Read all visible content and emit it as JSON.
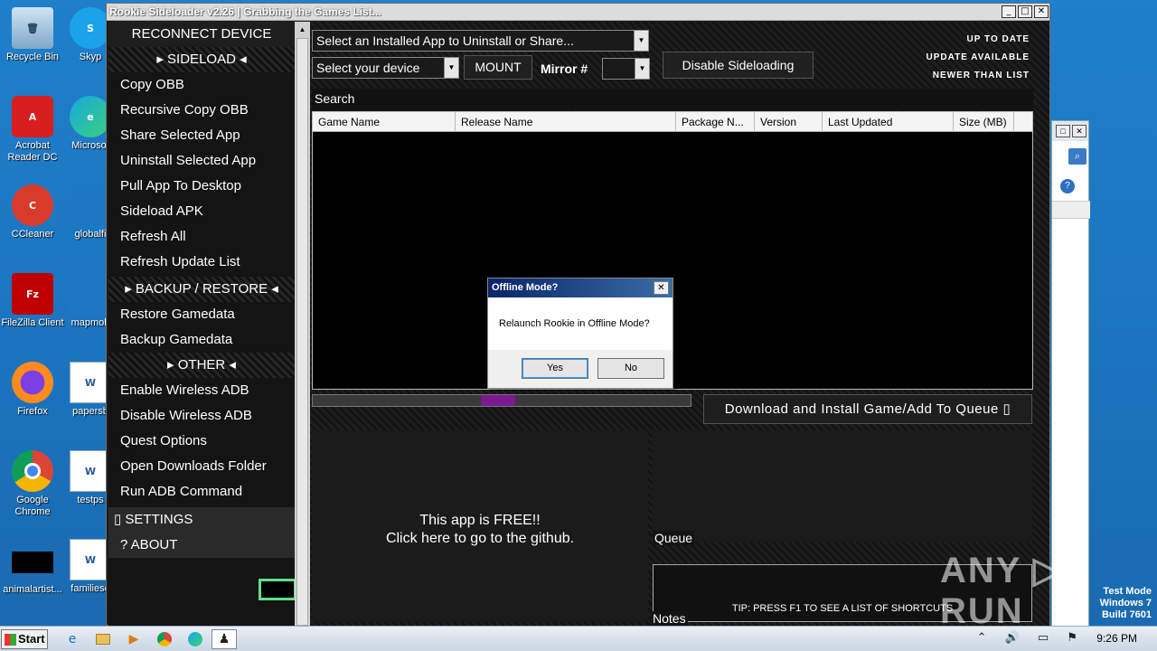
{
  "desktop": {
    "icons": [
      {
        "label": "Recycle Bin"
      },
      {
        "label": "Skyp"
      },
      {
        "label": "Acrobat Reader DC"
      },
      {
        "label": "Microsof"
      },
      {
        "label": "CCleaner"
      },
      {
        "label": "globalfi"
      },
      {
        "label": "FileZilla Client"
      },
      {
        "label": "mapmob"
      },
      {
        "label": "Firefox"
      },
      {
        "label": "papersb"
      },
      {
        "label": "Google Chrome"
      },
      {
        "label": "testps"
      },
      {
        "label": "animalartist..."
      },
      {
        "label": "familiese"
      }
    ]
  },
  "window": {
    "title": "Rookie Sideloader v2.26 | Grabbing the Games List..."
  },
  "sidebar": {
    "reconnect": "RECONNECT DEVICE",
    "sideload_header": "▸ SIDELOAD ◂",
    "sideload_items": [
      "Copy OBB",
      "Recursive Copy OBB",
      "Share Selected App",
      "Uninstall Selected App",
      "Pull App To Desktop",
      "Sideload APK",
      "Refresh All",
      "Refresh Update List"
    ],
    "backup_header": "▸ BACKUP / RESTORE ◂",
    "backup_items": [
      "Restore Gamedata",
      "Backup Gamedata"
    ],
    "other_header": "▸ OTHER ◂",
    "other_items": [
      "Enable  Wireless ADB",
      "Disable Wireless ADB",
      "Quest Options",
      "Open Downloads Folder",
      "Run ADB Command"
    ],
    "settings": "▯ SETTINGS",
    "about": "?   ABOUT"
  },
  "toolbar": {
    "installed_app_select": "Select an Installed App to Uninstall or Share...",
    "device_select": "Select your device",
    "mount_button": "MOUNT",
    "mirror_label": "Mirror #",
    "mirror_select": "",
    "disable_sideloading_button": "Disable Sideloading"
  },
  "status_legend": [
    "UP TO DATE",
    "UPDATE AVAILABLE",
    "NEWER THAN LIST"
  ],
  "search": {
    "label": "Search"
  },
  "games_table": {
    "columns": [
      "Game Name",
      "Release Name",
      "Package N...",
      "Version",
      "Last Updated",
      "Size (MB)"
    ],
    "rows": []
  },
  "download": {
    "button": "Download and Install Game/Add To Queue ▯",
    "progress_fraction": 0.09
  },
  "free_pane": {
    "line1": "This app is FREE!!",
    "line2": "Click here to go to the github."
  },
  "queue": {
    "label": "Queue"
  },
  "notes": {
    "label": "Notes",
    "tip": "TIP: PRESS F1 TO SEE A LIST OF SHORTCUTS"
  },
  "dialog": {
    "title": "Offline Mode?",
    "message": "Relaunch Rookie in Offline Mode?",
    "yes": "Yes",
    "no": "No"
  },
  "watermark": "ANY ▷ RUN",
  "os_badge": [
    "Test Mode",
    "Windows 7",
    "Build 7601"
  ],
  "taskbar": {
    "start": "Start",
    "clock": "9:26 PM"
  }
}
